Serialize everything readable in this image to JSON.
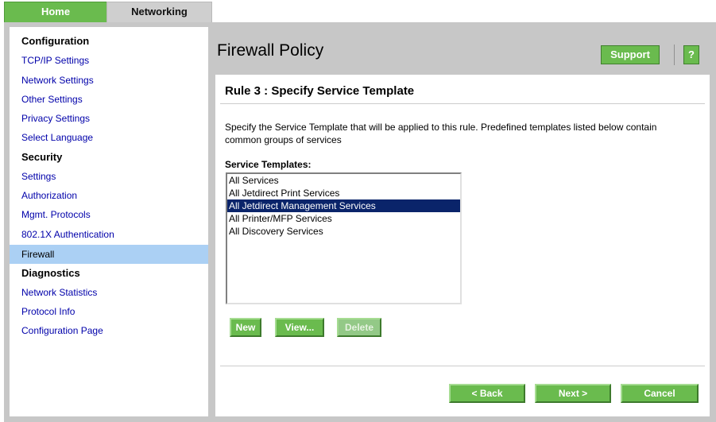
{
  "tabs": {
    "home": "Home",
    "networking": "Networking"
  },
  "sidebar": {
    "sections": [
      {
        "heading": "Configuration",
        "items": [
          "TCP/IP Settings",
          "Network Settings",
          "Other Settings",
          "Privacy Settings",
          "Select Language"
        ]
      },
      {
        "heading": "Security",
        "items": [
          "Settings",
          "Authorization",
          "Mgmt. Protocols",
          "802.1X Authentication",
          "Firewall"
        ]
      },
      {
        "heading": "Diagnostics",
        "items": [
          "Network Statistics",
          "Protocol Info",
          "Configuration Page"
        ]
      }
    ],
    "active_item": "Firewall"
  },
  "header": {
    "title": "Firewall Policy",
    "support_label": "Support",
    "help_label": "?"
  },
  "main": {
    "rule_title": "Rule 3 : Specify Service Template",
    "description": "Specify the Service Template that will be applied to this rule. Predefined templates listed below contain common groups of services",
    "list_label": "Service Templates:",
    "templates": [
      "All Services",
      "All Jetdirect Print Services",
      "All Jetdirect Management Services",
      "All Printer/MFP Services",
      "All Discovery Services"
    ],
    "selected_template": "All Jetdirect Management Services",
    "buttons": {
      "new": "New",
      "view": "View...",
      "delete": "Delete"
    },
    "nav_buttons": {
      "back": "< Back",
      "next": "Next >",
      "cancel": "Cancel"
    }
  },
  "colors": {
    "accent_green": "#6abb4e",
    "selection": "#0a246a",
    "sidebar_active": "#abd0f4",
    "link_blue": "#0000aa"
  }
}
